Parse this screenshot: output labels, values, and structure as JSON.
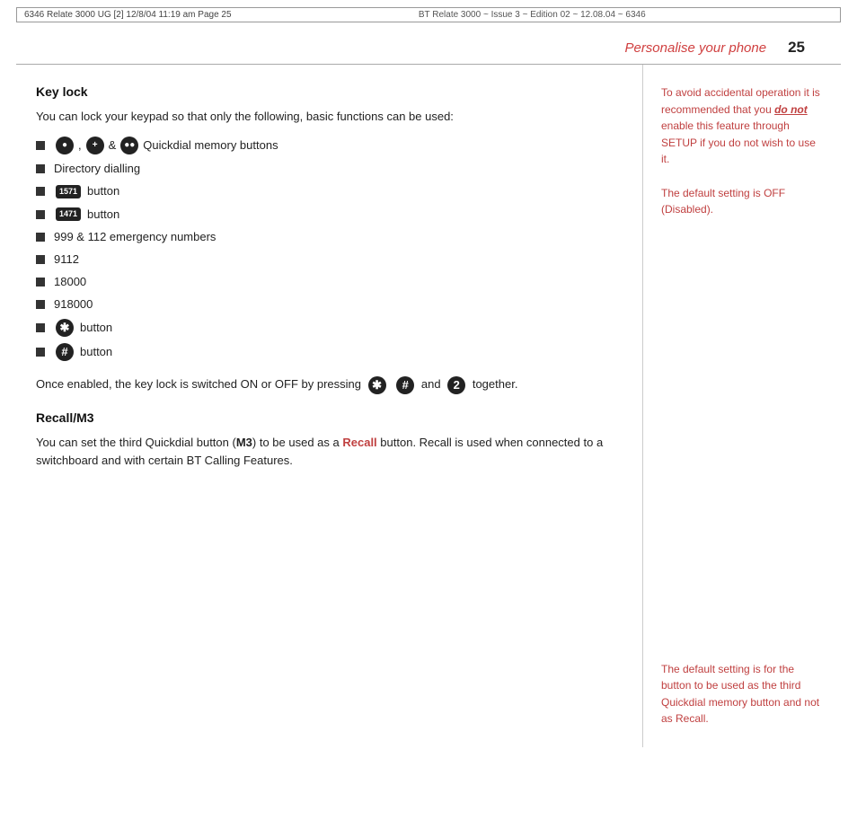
{
  "topHeader": {
    "left": "6346 Relate 3000 UG [2]   12/8/04   11:19 am   Page 25",
    "center": "BT Relate 3000 ~ Issue 3 ~ Edition 02 ~ 12.08.04 ~ 6346"
  },
  "pageHeader": {
    "title": "Personalise your phone",
    "pageNumber": "25"
  },
  "keyLock": {
    "heading": "Key lock",
    "intro": "You can lock your keypad so that only the following, basic functions can be used:",
    "bullets": [
      {
        "type": "quickdial",
        "text": "Quickdial memory buttons"
      },
      {
        "type": "text",
        "text": "Directory dialling"
      },
      {
        "type": "1571",
        "text": "button"
      },
      {
        "type": "1471",
        "text": "button"
      },
      {
        "type": "text",
        "text": "999 & 112 emergency numbers"
      },
      {
        "type": "text",
        "text": "9112"
      },
      {
        "type": "text",
        "text": "18000"
      },
      {
        "type": "text",
        "text": "918000"
      },
      {
        "type": "star",
        "text": "button"
      },
      {
        "type": "hash",
        "text": "button"
      }
    ],
    "onceEnabled": "Once enabled, the key lock is switched ON or OFF by pressing",
    "onceEnabledEnd": "together.",
    "andText": "and"
  },
  "recallM3": {
    "heading": "Recall/M3",
    "intro": "You can set the third Quickdial button (",
    "m3Label": "M3",
    "introEnd": ") to be used as a",
    "recallLabel": "Recall",
    "recallEnd": "button. Recall is used when connected to a switchboard and with certain BT Calling Features."
  },
  "sidebar": {
    "topNote": "To avoid accidental operation it is recommended that you",
    "doNotText": "do not",
    "topNoteEnd": "enable this feature through SETUP if you do not wish to use it.",
    "defaultOff": "The default setting is OFF (Disabled).",
    "bottomNote": "The default setting is for the button to be used as the third Quickdial memory button and not as Recall."
  },
  "icons": {
    "quickdialButtons": [
      "●",
      "+",
      "&",
      "●●"
    ],
    "starSymbol": "*",
    "hashSymbol": "#",
    "twoSymbol": "2"
  }
}
